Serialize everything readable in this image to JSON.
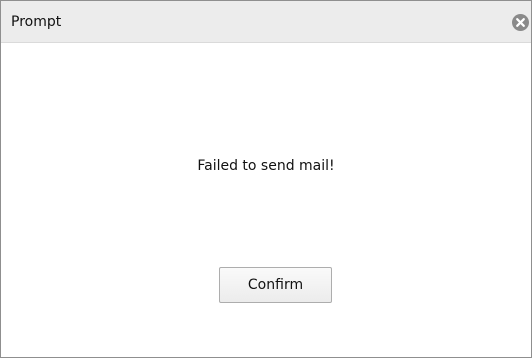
{
  "dialog": {
    "title": "Prompt",
    "message": "Failed to send mail!",
    "confirm_label": "Confirm",
    "close_icon": "close-icon"
  },
  "colors": {
    "titlebar_bg": "#ececec",
    "close_icon_bg": "#8a8a8a",
    "button_border": "#adadad",
    "text": "#111111"
  }
}
